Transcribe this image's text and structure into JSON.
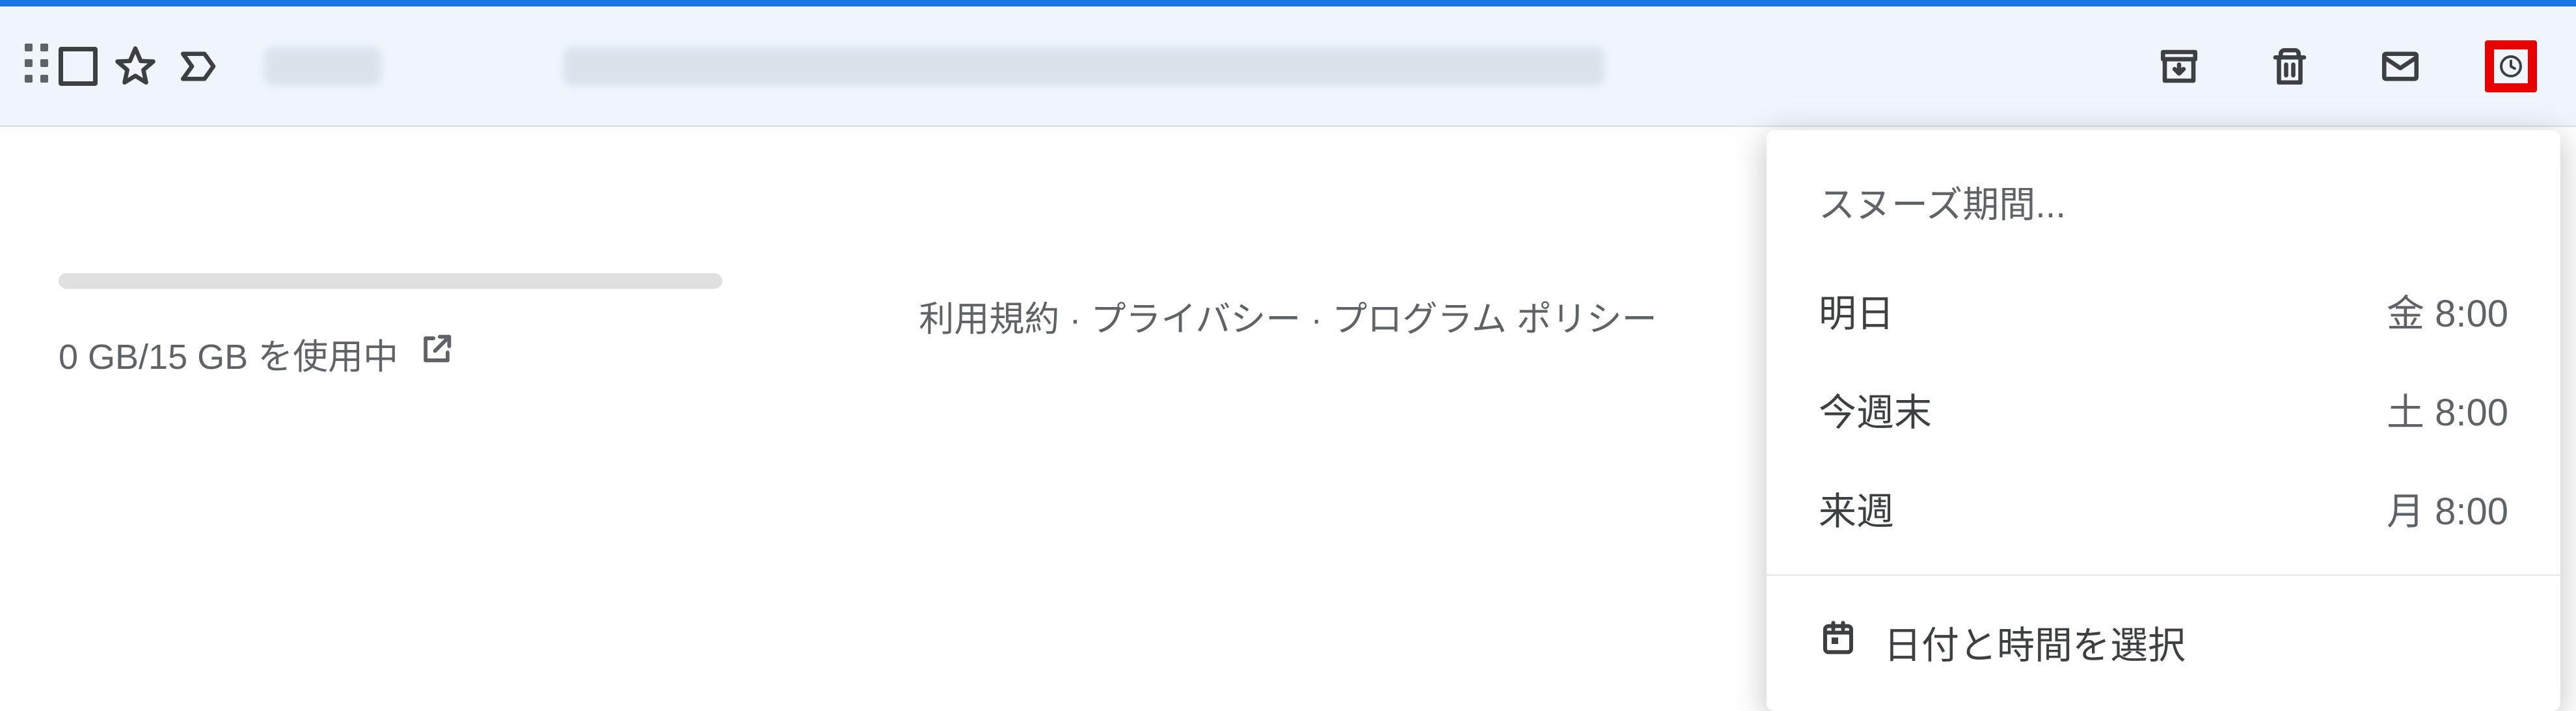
{
  "footer": {
    "storage_text": "0 GB/15 GB を使用中",
    "links": {
      "terms": "利用規約",
      "privacy": "プライバシー",
      "program": "プログラム ポリシー",
      "sep": " · "
    }
  },
  "snooze": {
    "header": "スヌーズ期間...",
    "options": [
      {
        "label": "明日",
        "when": "金 8:00"
      },
      {
        "label": "今週末",
        "when": "土 8:00"
      },
      {
        "label": "来週",
        "when": "月 8:00"
      }
    ],
    "pick_label": "日付と時間を選択"
  }
}
